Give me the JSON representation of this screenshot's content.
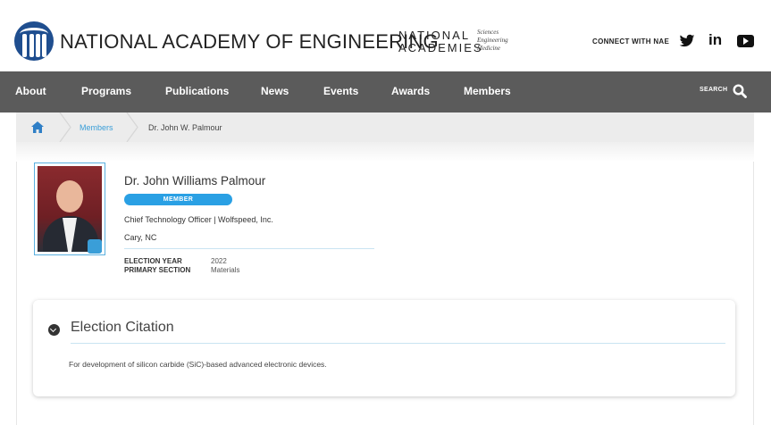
{
  "header": {
    "org_title": "NATIONAL ACADEMY OF ENGINEERING",
    "na_line1": "NATIONAL",
    "na_line2": "ACADEMIES",
    "na_sub": [
      "Sciences",
      "Engineering",
      "Medicine"
    ],
    "connect_label": "CONNECT WITH NAE",
    "social_icons": [
      "twitter-icon",
      "linkedin-icon",
      "youtube-icon"
    ],
    "linkedin_text": "in"
  },
  "nav": {
    "items": [
      "About",
      "Programs",
      "Publications",
      "News",
      "Events",
      "Awards",
      "Members"
    ],
    "search_label": "SEARCH"
  },
  "breadcrumb": {
    "home_icon": "home-icon",
    "items": [
      "Members",
      "Dr. John W. Palmour"
    ]
  },
  "profile": {
    "name": "Dr. John Williams Palmour",
    "badge": "MEMBER",
    "title": "Chief Technology Officer | Wolfspeed, Inc.",
    "location": "Cary, NC",
    "election_year_label": "ELECTION YEAR",
    "election_year": "2022",
    "primary_section_label": "PRIMARY SECTION",
    "primary_section": "Materials"
  },
  "citation": {
    "heading": "Election Citation",
    "text": "For development of silicon carbide (SiC)-based advanced electronic devices."
  },
  "colors": {
    "nav_bg": "#5b5b5b",
    "accent_blue": "#2aa0e4",
    "link_blue": "#3a9ed8",
    "seal_blue": "#1f4e8f"
  }
}
